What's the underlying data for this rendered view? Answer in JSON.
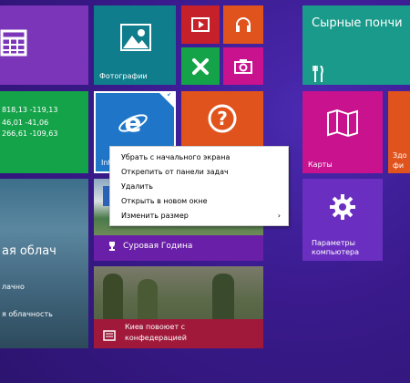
{
  "colors": {
    "background": "#3a1a8c",
    "purple_tile": "#7b35b8",
    "teal_tile": "#0f7d8c",
    "red_tile": "#c6202a",
    "green_tile": "#15a34a",
    "orange_tile": "#e0531d",
    "magenta_tile": "#c8128e",
    "blue_tile": "#1f76c9"
  },
  "tiles": {
    "calendar": {
      "icon": "calendar-icon"
    },
    "photos": {
      "label": "Фотографии",
      "icon": "photos-icon"
    },
    "video": {
      "icon": "video-icon"
    },
    "music": {
      "icon": "headphones-icon"
    },
    "games": {
      "icon": "xbox-icon"
    },
    "camera": {
      "icon": "camera-icon"
    },
    "food": {
      "title": "Сырные пончи",
      "icon": "fork-knife-icon"
    },
    "finance": {
      "lines": [
        "818,13 -119,13",
        "46,01 -41,06",
        "266,61 -109,63"
      ]
    },
    "ie": {
      "label": "Inter",
      "icon": "internet-explorer-icon"
    },
    "help": {
      "icon": "help-icon"
    },
    "maps": {
      "label": "Карты",
      "icon": "map-icon"
    },
    "health": {
      "label_line1": "Здо",
      "label_line2": "фи"
    },
    "weather": {
      "condition": "ая облач",
      "line1": "лачно",
      "line2": "я облачность"
    },
    "news_top": {
      "caption": "Суровая Година",
      "icon": "trophy-icon"
    },
    "settings": {
      "label_line1": "Параметры",
      "label_line2": "компьютера",
      "icon": "gear-icon"
    },
    "news_bottom": {
      "line1": "Киев повоюет с",
      "line2": "конфедерацией",
      "icon": "news-icon"
    }
  },
  "context_menu": {
    "items": [
      "Убрать с начального экрана",
      "Открепить от панели задач",
      "Удалить",
      "Открыть в новом окне",
      "Изменить размер"
    ],
    "submenu_arrow": "›"
  }
}
